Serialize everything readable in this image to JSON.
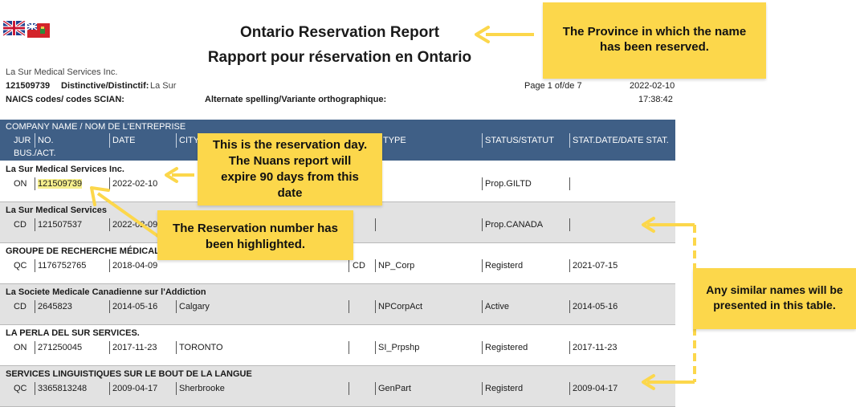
{
  "header": {
    "title_en": "Ontario Reservation Report",
    "title_fr": "Rapport pour réservation en Ontario",
    "company": "La Sur Medical Services Inc.",
    "number": "121509739",
    "distinctive_label": "Distinctive/Distinctif:",
    "distinctive_value": "La Sur",
    "naics_label": "NAICS codes/ codes SCIAN:",
    "alternate_label": "Alternate spelling/Variante orthographique:",
    "page": "Page 1 of/de 7",
    "date": "2022-02-10",
    "time": "17:38:42"
  },
  "table": {
    "header_company": "COMPANY NAME / NOM DE L'ENTREPRISE",
    "col_jur": "JUR",
    "col_no": "NO.",
    "col_date": "DATE",
    "col_city": "CITY",
    "col_type": "TYPE",
    "col_status": "STATUS/STATUT",
    "col_statdate": "STAT.DATE/DATE STAT.",
    "col_bus": "BUS./ACT.",
    "rows": [
      {
        "name": "La Sur Medical Services Inc.",
        "jur": "ON",
        "no": "121509739",
        "date": "2022-02-10",
        "city": "",
        "bus": "",
        "type": "",
        "status": "Prop.GILTD",
        "statdate": ""
      },
      {
        "name": "La Sur Medical Services",
        "jur": "CD",
        "no": "121507537",
        "date": "2022-02-09",
        "city": "",
        "bus": "",
        "type": "",
        "status": "Prop.CANADA",
        "statdate": ""
      },
      {
        "name": "GROUPE DE RECHERCHE MÉDICALE S",
        "jur": "QC",
        "no": "1176752765",
        "date": "2018-04-09",
        "city": "",
        "bus": "CD",
        "type": "NP_Corp",
        "status": "Registerd",
        "statdate": "2021-07-15"
      },
      {
        "name": "La Societe Medicale Canadienne sur l'Addiction",
        "jur": "CD",
        "no": "2645823",
        "date": "2014-05-16",
        "city": "Calgary",
        "bus": "",
        "type": "NPCorpAct",
        "status": "Active",
        "statdate": "2014-05-16"
      },
      {
        "name": "LA PERLA DEL SUR SERVICES.",
        "jur": "ON",
        "no": "271250045",
        "date": "2017-11-23",
        "city": "TORONTO",
        "bus": "",
        "type": "SI_Prpshp",
        "status": "Registered",
        "statdate": "2017-11-23"
      },
      {
        "name": "SERVICES LINGUISTIQUES SUR LE BOUT DE LA LANGUE",
        "jur": "QC",
        "no": "3365813248",
        "date": "2009-04-17",
        "city": "Sherbrooke",
        "bus": "",
        "type": "GenPart",
        "status": "Registerd",
        "statdate": "2009-04-17"
      }
    ]
  },
  "callouts": {
    "province_1": "The Province in which the name",
    "province_2": "has been reserved.",
    "day_1": "This is the reservation day.",
    "day_2": "The Nuans report will",
    "day_3": "expire 90 days from this",
    "day_4": "date",
    "number_1": "The Reservation number has",
    "number_2": "been highlighted.",
    "similar_1": "Any similar names will be",
    "similar_2": "presented in this table."
  },
  "colors": {
    "header_bg": "#3f5f86",
    "row_alt": "#e2e2e2",
    "callout": "#fcd74b",
    "highlight": "#f6ef8d"
  }
}
